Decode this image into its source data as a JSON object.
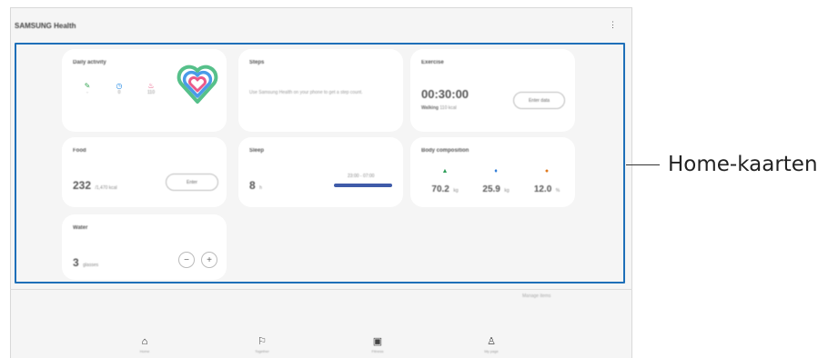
{
  "app": {
    "title": "SAMSUNG Health",
    "more_icon": "more-vertical-icon"
  },
  "cards": {
    "daily_activity": {
      "title": "Daily activity",
      "stats": [
        {
          "icon": "steps-icon",
          "value": "-",
          "color": "#3aa757"
        },
        {
          "icon": "active-time-icon",
          "value": "0",
          "color": "#1e88e5"
        },
        {
          "icon": "calories-icon",
          "value": "110",
          "color": "#e5396b"
        }
      ],
      "ring_colors": [
        "#56c08a",
        "#4a9be8",
        "#ea5a8a"
      ]
    },
    "steps": {
      "title": "Steps",
      "text": "Use Samsung Health on your phone to get a step count."
    },
    "exercise": {
      "title": "Exercise",
      "time": "00:30:00",
      "sub": "Walking",
      "sub_value": "110 kcal",
      "button": "Enter data"
    },
    "food": {
      "title": "Food",
      "value": "232",
      "unit": "/1,470 kcal",
      "button": "Enter"
    },
    "sleep": {
      "title": "Sleep",
      "value": "8",
      "unit": "h",
      "range": "23:00 - 07:00",
      "bar_color": "#3f5ba9"
    },
    "body_composition": {
      "title": "Body composition",
      "items": [
        {
          "icon": "weight-icon",
          "value": "70.2",
          "unit": "kg",
          "color": "#2e9e5a"
        },
        {
          "icon": "muscle-icon",
          "value": "25.9",
          "unit": "kg",
          "color": "#2e7bd6"
        },
        {
          "icon": "fat-icon",
          "value": "12.0",
          "unit": "%",
          "color": "#e07a1f"
        }
      ]
    },
    "water": {
      "title": "Water",
      "value": "3",
      "unit": "glasses",
      "minus": "−",
      "plus": "+"
    }
  },
  "manage_link": "Manage items",
  "nav": [
    {
      "label": "Home",
      "icon": "home-icon",
      "glyph": "⌂",
      "active": true
    },
    {
      "label": "Together",
      "icon": "flag-icon",
      "glyph": "⚐",
      "active": false
    },
    {
      "label": "Fitness",
      "icon": "fitness-icon",
      "glyph": "▣",
      "active": false
    },
    {
      "label": "My page",
      "icon": "person-icon",
      "glyph": "♙",
      "active": false
    }
  ],
  "callout": {
    "label": "Home-kaarten",
    "color": "#1e6fb8"
  }
}
